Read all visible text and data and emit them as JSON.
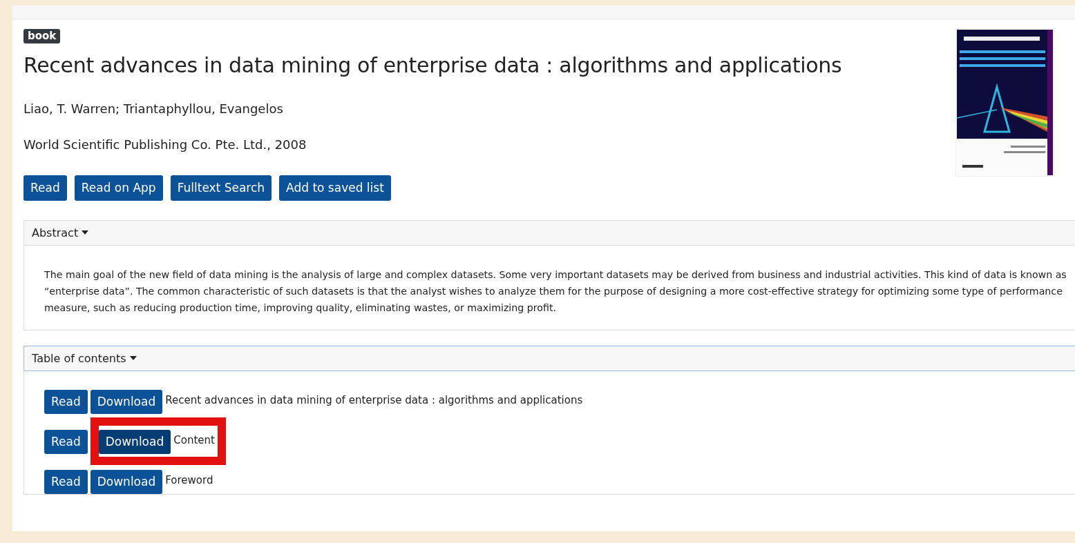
{
  "badge": "book",
  "title": "Recent advances in data mining of enterprise data : algorithms and applications",
  "authors": "Liao, T. Warren; Triantaphyllou, Evangelos",
  "publisher": "World Scientific Publishing Co. Pte. Ltd., 2008",
  "actions": [
    "Read",
    "Read on App",
    "Fulltext Search",
    "Add to saved list"
  ],
  "abstract": {
    "label": "Abstract",
    "expanded": true,
    "text": "The main goal of the new field of data mining is the analysis of large and complex datasets. Some very important datasets may be derived from business and industrial activities. This kind of data is known as “enterprise data”. The common characteristic of such datasets is that the analyst wishes to analyze them for the purpose of designing a more cost-effective strategy for optimizing some type of performance measure, such as reducing production time, improving quality, eliminating wastes, or maximizing profit."
  },
  "toc": {
    "label": "Table of contents",
    "expanded": true,
    "items": [
      {
        "read": "Read",
        "download": "Download",
        "title": "Recent advances in data mining of enterprise data : algorithms and applications",
        "highlighted": false
      },
      {
        "read": "Read",
        "download": "Download",
        "title": "Content",
        "highlighted": true
      },
      {
        "read": "Read",
        "download": "Download",
        "title": "Foreword",
        "highlighted": false
      }
    ]
  }
}
